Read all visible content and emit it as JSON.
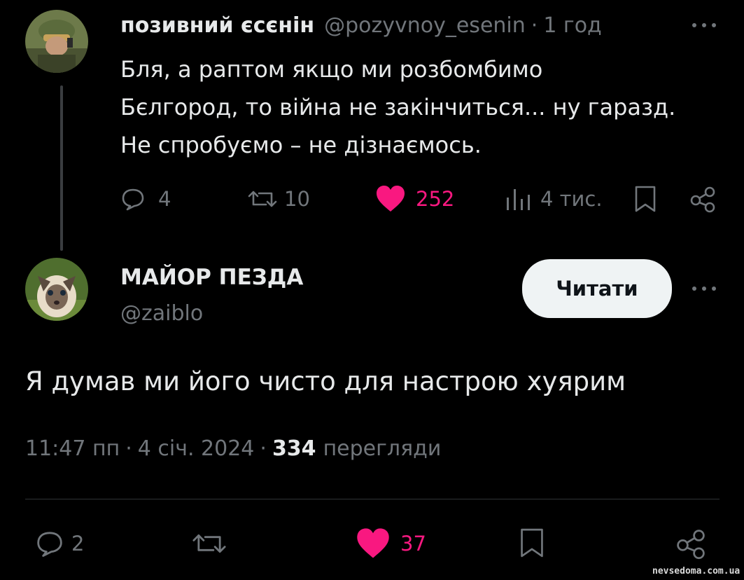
{
  "parent_tweet": {
    "display_name": "позивний єсєнін",
    "handle": "@pozyvnoy_esenin",
    "separator": "·",
    "time_ago": "1 год",
    "more": "···",
    "text_lines": [
      "Бля, а раптом якщо ми розбомбимо",
      "Бєлгород, то війна не закінчиться... ну гаразд.",
      "Не спробуємо – не дізнаємось."
    ],
    "actions": {
      "replies": "4",
      "retweets": "10",
      "likes": "252",
      "views": "4 тис."
    }
  },
  "reply_tweet": {
    "display_name": "МАЙОР ПЕЗДА",
    "handle": "@zaiblo",
    "follow_label": "Читати",
    "more": "···",
    "text": "Я думав ми його чисто для настрою хуярим",
    "meta": {
      "time": "11:47 пп",
      "sep1": "·",
      "date": "4 січ. 2024",
      "sep2": "·",
      "views_count": "334",
      "views_label": "перегляди"
    },
    "actions": {
      "replies": "2",
      "likes": "37"
    }
  },
  "watermark": "nevsedoma.com.ua",
  "colors": {
    "background": "#000000",
    "text": "#e7e9ea",
    "muted": "#71767b",
    "like": "#f91880",
    "button_bg": "#eff3f4"
  },
  "icons": {
    "reply": "comment-bubble-icon",
    "retweet": "retweet-icon",
    "like": "heart-filled-icon",
    "views": "bar-chart-icon",
    "bookmark": "bookmark-icon",
    "share": "share-icon",
    "more": "more-dots-icon"
  }
}
